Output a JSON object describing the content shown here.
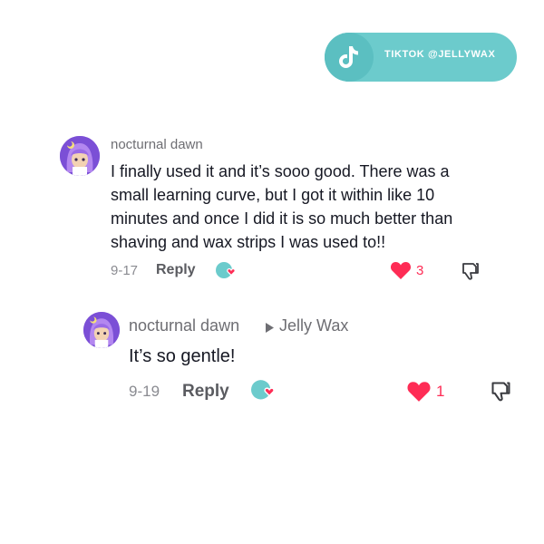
{
  "badge": {
    "text": "TIKTOK @JELLYWAX",
    "icon": "tiktok-logo-icon"
  },
  "comments": [
    {
      "author": "nocturnal dawn",
      "text": "I finally used it and it’s sooo good. There was a small learning curve, but I got it within like 10 minutes and once I did it is so much better than shaving and wax strips I was used to!!",
      "date": "9-17",
      "reply_label": "Reply",
      "likes": "3"
    },
    {
      "author": "nocturnal dawn",
      "reply_to": "Jelly Wax",
      "text": "It’s so gentle!",
      "date": "9-19",
      "reply_label": "Reply",
      "likes": "1"
    }
  ],
  "colors": {
    "badge": "#6ccbcc",
    "like": "#fe2c55",
    "avatar": "#7b4fd6"
  }
}
